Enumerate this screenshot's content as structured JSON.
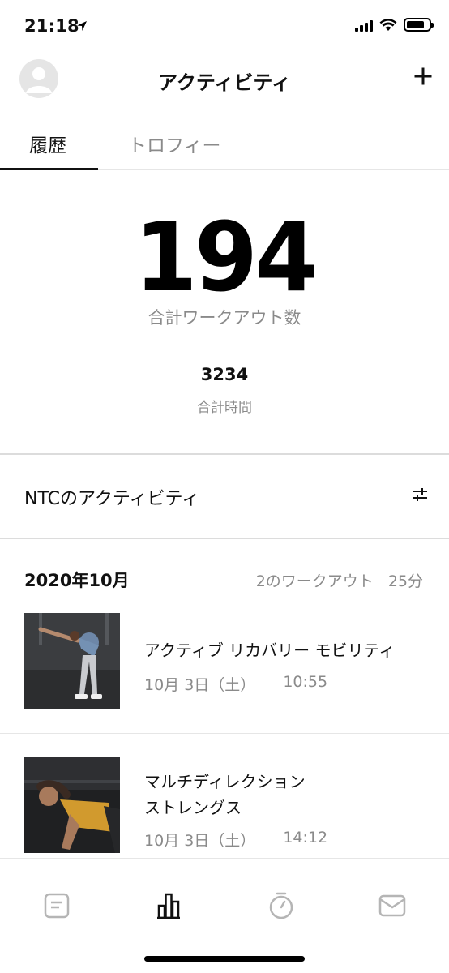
{
  "status_bar": {
    "time": "21:18"
  },
  "header": {
    "title": "アクティビティ",
    "add_icon": "plus-icon",
    "avatar_icon": "user-avatar"
  },
  "tabs": [
    {
      "label": "履歴",
      "active": true
    },
    {
      "label": "トロフィー",
      "active": false
    }
  ],
  "stats": {
    "total_workouts": "194",
    "total_workouts_label": "合計ワークアウト数",
    "total_time": "3234",
    "total_time_label": "合計時間"
  },
  "activity_section": {
    "title": "NTCのアクティビティ",
    "filter_icon": "sliders-icon"
  },
  "month": {
    "label": "2020年10月",
    "workouts": "2のワークアウト",
    "minutes": "25分"
  },
  "workouts": [
    {
      "title": "アクティブ リカバリー モビリティ",
      "title_line2": "",
      "date": "10月 3日（土）",
      "time": "10:55"
    },
    {
      "title": "マルチディレクション",
      "title_line2": "ストレングス",
      "date": "10月 3日（土）",
      "time": "14:12"
    }
  ],
  "bottom_nav": [
    {
      "icon": "feed-icon",
      "active": false
    },
    {
      "icon": "activity-bars-icon",
      "active": true
    },
    {
      "icon": "stopwatch-icon",
      "active": false
    },
    {
      "icon": "inbox-icon",
      "active": false
    }
  ],
  "colors": {
    "primary": "#111111",
    "muted": "#8a8a8a",
    "divider": "#dcdcdc",
    "inactive_icon": "#b5b5b5"
  }
}
